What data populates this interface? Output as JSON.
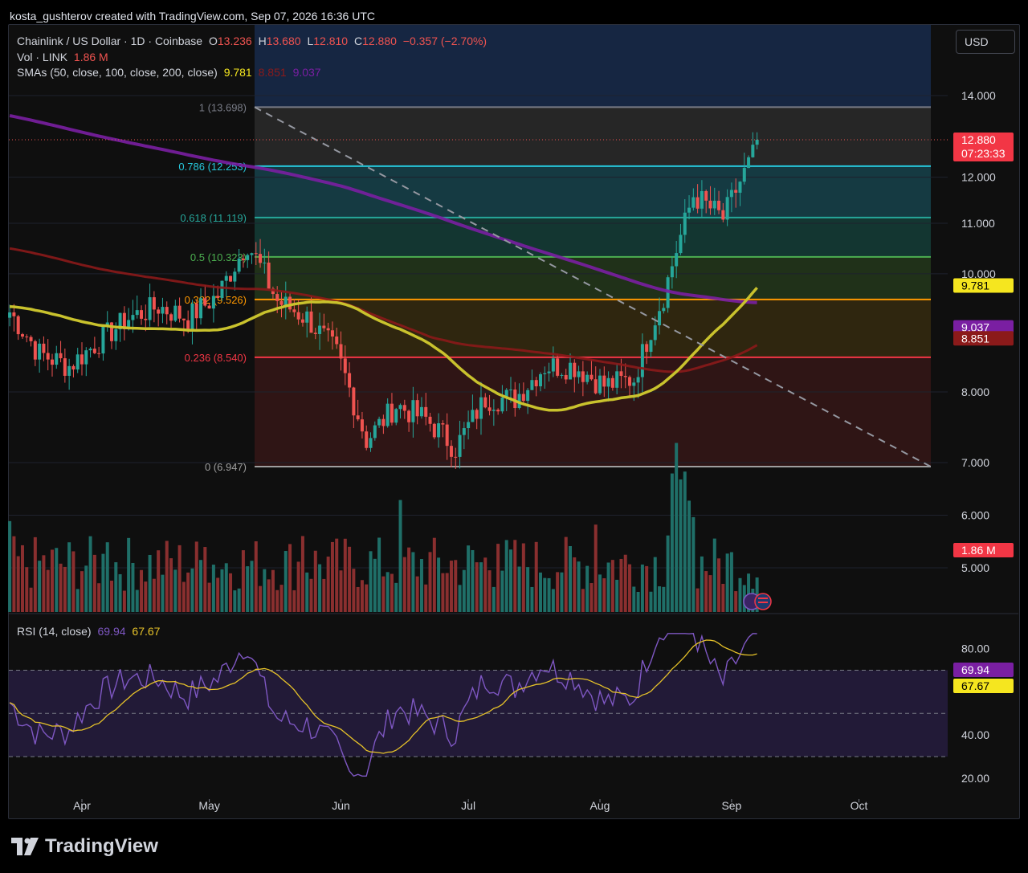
{
  "header": {
    "attribution": "kosta_gushterov created with TradingView.com, Sep 07, 2026 16:36 UTC",
    "currency": "USD",
    "brand": "TradingView"
  },
  "legend": {
    "symbol": "Chainlink / US Dollar · 1D · Coinbase",
    "o_label": "O",
    "o_value": "13.236",
    "h_label": "H",
    "h_value": "13.680",
    "l_label": "L",
    "l_value": "12.810",
    "c_label": "C",
    "c_value": "12.880",
    "change": "−0.357 (−2.70%)",
    "vol_label": "Vol · LINK",
    "vol_value": "1.86 M",
    "sma_label": "SMAs (50, close, 100, close, 200, close)",
    "sma50": "9.781",
    "sma100": "8.851",
    "sma200": "9.037",
    "rsi_label": "RSI (14, close)",
    "rsi_value": "69.94",
    "rsi_ma": "67.67"
  },
  "colors": {
    "up": "#26a69a",
    "down": "#ef5350",
    "sma50": "#c9c22d",
    "sma100": "#8b1a1a",
    "sma200": "#7a1fa2",
    "rsi": "#7e57c2",
    "rsi_ma": "#e6c229"
  },
  "chart_data": [
    {
      "type": "candlestick",
      "x_ticks": [
        "Apr",
        "May",
        "Jun",
        "Jul",
        "Aug",
        "Sep",
        "Oct"
      ],
      "y_ticks": [
        "5.000",
        "6.000",
        "7.000",
        "8.000",
        "10.000",
        "11.000",
        "12.000",
        "14.000"
      ],
      "y_scale": "log",
      "last_price": "12.880",
      "countdown": "07:23:33",
      "price_badges": [
        {
          "label": "9.781",
          "value": 9.781,
          "color": "#f5e61f",
          "text": "#000"
        },
        {
          "label": "9.037",
          "value": 9.037,
          "color": "#7a1fa2",
          "text": "#fff"
        },
        {
          "label": "8.851",
          "value": 8.851,
          "color": "#8b1a1a",
          "text": "#fff"
        }
      ],
      "fib_levels": [
        {
          "label": "1 (13.698)",
          "value": 13.698,
          "color": "#787b86"
        },
        {
          "label": "0.786 (12.253)",
          "value": 12.253,
          "color": "#26c6da"
        },
        {
          "label": "0.618 (11.119)",
          "value": 11.119,
          "color": "#26a69a"
        },
        {
          "label": "0.5 (10.323)",
          "value": 10.323,
          "color": "#4caf50"
        },
        {
          "label": "0.382 (9.526)",
          "value": 9.526,
          "color": "#ff9800"
        },
        {
          "label": "0.236 (8.540)",
          "value": 8.54,
          "color": "#f23645"
        },
        {
          "label": "0 (6.947)",
          "value": 6.947,
          "color": "#9e9e9e"
        }
      ],
      "series": [
        {
          "name": "SMA 50",
          "last": 9.781
        },
        {
          "name": "SMA 100",
          "last": 8.851
        },
        {
          "name": "SMA 200",
          "last": 9.037
        }
      ],
      "close_path": [
        [
          "Mar 15",
          9.3
        ],
        [
          "Mar 22",
          8.6
        ],
        [
          "Mar 29",
          8.4
        ],
        [
          "Apr 05",
          8.8
        ],
        [
          "Apr 12",
          9.2
        ],
        [
          "Apr 19",
          9.4
        ],
        [
          "Apr 26",
          9.2
        ],
        [
          "May 03",
          9.6
        ],
        [
          "May 10",
          10.6
        ],
        [
          "May 17",
          9.5
        ],
        [
          "May 24",
          9.2
        ],
        [
          "May 31",
          8.6
        ],
        [
          "Jun 07",
          7.3
        ],
        [
          "Jun 14",
          7.8
        ],
        [
          "Jun 21",
          7.6
        ],
        [
          "Jun 28",
          7.2
        ],
        [
          "Jul 05",
          7.9
        ],
        [
          "Jul 12",
          7.9
        ],
        [
          "Jul 19",
          8.4
        ],
        [
          "Jul 26",
          8.4
        ],
        [
          "Aug 02",
          8.1
        ],
        [
          "Aug 09",
          8.2
        ],
        [
          "Aug 16",
          9.6
        ],
        [
          "Aug 23",
          11.6
        ],
        [
          "Aug 30",
          11.1
        ],
        [
          "Sep 06",
          12.5
        ],
        [
          "Sep 07",
          12.88
        ]
      ]
    },
    {
      "type": "bar",
      "name": "Volume",
      "last_value": "1.86 M"
    },
    {
      "type": "line",
      "name": "RSI",
      "y_ticks": [
        "20.00",
        "40.00",
        "80.00"
      ],
      "bands": [
        30,
        50,
        70
      ],
      "last_value": "69.94",
      "ma_value": "67.67"
    }
  ]
}
